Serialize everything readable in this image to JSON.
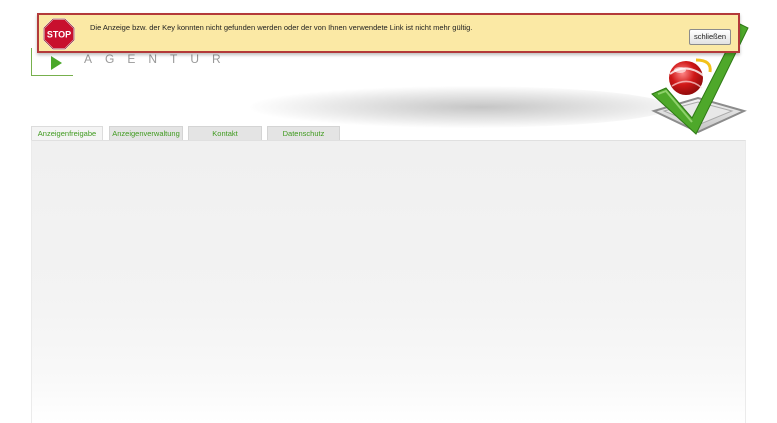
{
  "header": {
    "brand_subtitle": "AGENTUR"
  },
  "tabs": [
    {
      "label": "Anzeigenfreigabe",
      "active": true
    },
    {
      "label": "Anzeigenverwaltung",
      "active": false
    },
    {
      "label": "Kontakt",
      "active": false
    },
    {
      "label": "Datenschutz",
      "active": false
    }
  ],
  "alert": {
    "icon_text": "STOP",
    "message": "Die Anzeige bzw. der Key konnten nicht gefunden werden oder der von Ihnen verwendete Link ist nicht mehr gültig.",
    "close_label": "schließen"
  },
  "colors": {
    "accent_green": "#4aa82a",
    "alert_background": "#fbe9a5",
    "alert_border": "#b33a3a",
    "stop_red": "#c8102e"
  },
  "icons": {
    "stop": "stop-sign-icon",
    "logo": "checkmark-logo-icon",
    "play": "play-icon"
  }
}
